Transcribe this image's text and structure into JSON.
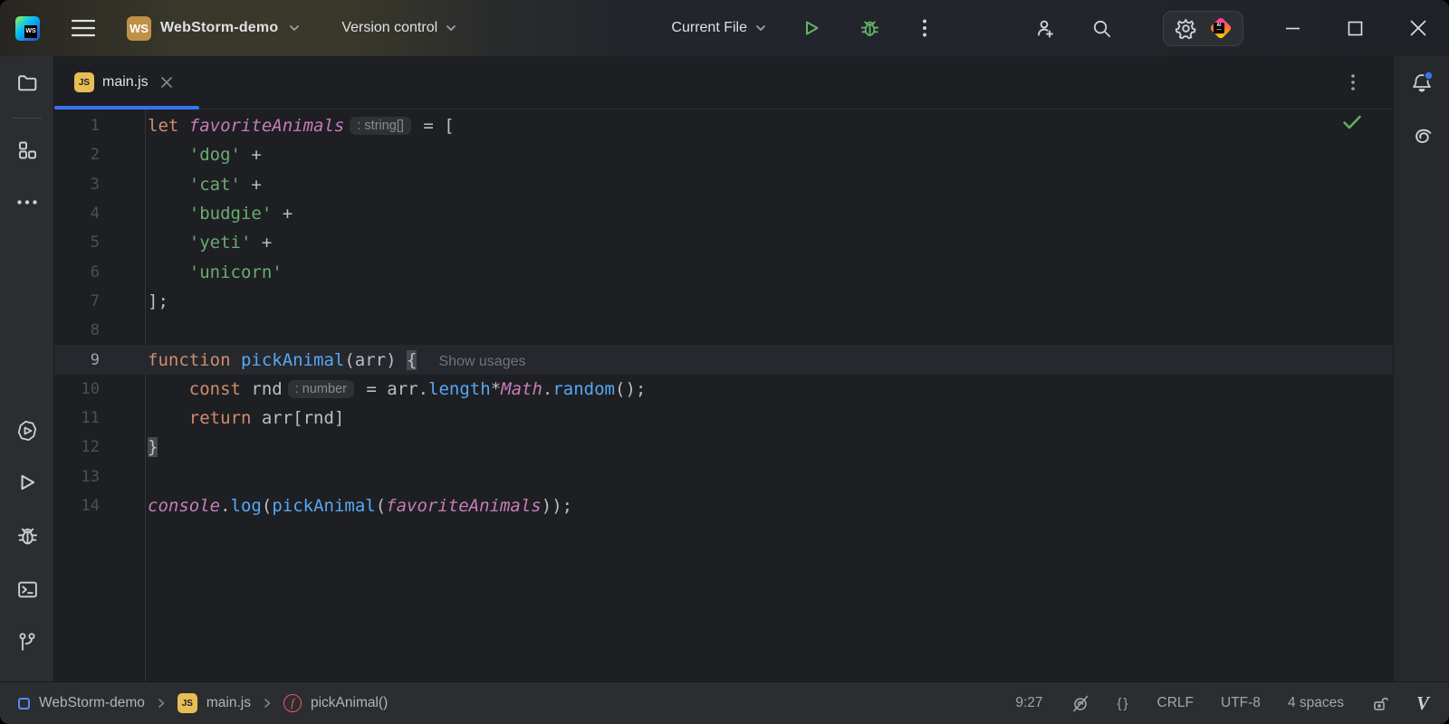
{
  "title_bar": {
    "app_icon_text": "WS",
    "project": {
      "icon_text": "WS",
      "name": "WebStorm-demo"
    },
    "vcs_widget": "Version control",
    "run_config": "Current File",
    "ai_logo_text": "AI"
  },
  "tab_bar": {
    "active_tab": {
      "icon_text": "JS",
      "label": "main.js"
    }
  },
  "editor": {
    "lines": [
      {
        "n": "1",
        "tokens": [
          [
            "kw",
            "let "
          ],
          [
            "gl",
            "favoriteAnimals"
          ],
          [
            "hint",
            ": string[]"
          ],
          [
            "pl",
            " = ["
          ]
        ]
      },
      {
        "n": "2",
        "tokens": [
          [
            "pl",
            "    "
          ],
          [
            "str",
            "'dog'"
          ],
          [
            "pl",
            " +"
          ]
        ]
      },
      {
        "n": "3",
        "tokens": [
          [
            "pl",
            "    "
          ],
          [
            "str",
            "'cat'"
          ],
          [
            "pl",
            " +"
          ]
        ]
      },
      {
        "n": "4",
        "tokens": [
          [
            "pl",
            "    "
          ],
          [
            "str",
            "'budgie'"
          ],
          [
            "pl",
            " +"
          ]
        ]
      },
      {
        "n": "5",
        "tokens": [
          [
            "pl",
            "    "
          ],
          [
            "str",
            "'yeti'"
          ],
          [
            "pl",
            " +"
          ]
        ]
      },
      {
        "n": "6",
        "tokens": [
          [
            "pl",
            "    "
          ],
          [
            "str",
            "'unicorn'"
          ]
        ]
      },
      {
        "n": "7",
        "tokens": [
          [
            "pl",
            "];"
          ]
        ]
      },
      {
        "n": "8",
        "tokens": []
      },
      {
        "n": "9",
        "current": true,
        "tokens": [
          [
            "kw",
            "function "
          ],
          [
            "fn",
            "pickAnimal"
          ],
          [
            "pl",
            "(arr) "
          ],
          [
            "brace",
            "{"
          ],
          [
            "usages",
            "Show usages"
          ]
        ]
      },
      {
        "n": "10",
        "tokens": [
          [
            "pl",
            "    "
          ],
          [
            "kw",
            "const "
          ],
          [
            "pl",
            "rnd"
          ],
          [
            "hint",
            ": number"
          ],
          [
            "pl",
            " = arr."
          ],
          [
            "fn",
            "length"
          ],
          [
            "pl",
            "*"
          ],
          [
            "gl",
            "Math"
          ],
          [
            "pl",
            "."
          ],
          [
            "fn",
            "random"
          ],
          [
            "pl",
            "();"
          ]
        ]
      },
      {
        "n": "11",
        "tokens": [
          [
            "pl",
            "    "
          ],
          [
            "kw",
            "return "
          ],
          [
            "pl",
            "arr[rnd]"
          ]
        ]
      },
      {
        "n": "12",
        "tokens": [
          [
            "brace",
            "}"
          ]
        ]
      },
      {
        "n": "13",
        "tokens": []
      },
      {
        "n": "14",
        "tokens": [
          [
            "gl",
            "console"
          ],
          [
            "pl",
            "."
          ],
          [
            "fn",
            "log"
          ],
          [
            "pl",
            "("
          ],
          [
            "fn",
            "pickAnimal"
          ],
          [
            "pl",
            "("
          ],
          [
            "gl",
            "favoriteAnimals"
          ],
          [
            "pl",
            "));"
          ]
        ]
      }
    ]
  },
  "status_bar": {
    "breadcrumbs": {
      "project": "WebStorm-demo",
      "file": "main.js",
      "file_icon_text": "JS",
      "symbol": "pickAnimal()",
      "symbol_icon_text": "f"
    },
    "caret_position": "9:27",
    "line_ending": "CRLF",
    "encoding": "UTF-8",
    "indent": "4 spaces",
    "vim_glyph": "V"
  },
  "icons": {
    "braces_glyph": "{}"
  },
  "colors": {
    "accent_blue": "#3574F0",
    "run_green": "#64b467",
    "tab_underline": "#3574F0",
    "js_icon_yellow": "#E8BE54",
    "project_icon_gold": "#BE9048",
    "function_red": "#F75464",
    "notification_badge_blue": "#3574F0",
    "editor_bg": "#1E1F22",
    "panel_bg": "#2B2D30",
    "string_green": "#6AAB73",
    "keyword_orange": "#CF8E6D",
    "method_blue": "#56A8F5",
    "global_purple": "#C77DBB"
  }
}
